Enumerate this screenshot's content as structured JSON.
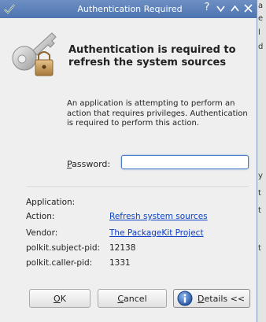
{
  "window": {
    "title": "Authentication Required",
    "help_glyph": "?",
    "minimize_glyph": "v",
    "maximize_glyph": "^",
    "close_glyph": "x"
  },
  "heading": "Authentication is required to refresh the system sources",
  "description": "An application is attempting to perform an action that requires privileges. Authentication is required to perform this action.",
  "password": {
    "label_mnemonic": "P",
    "label_rest": "assword:",
    "value": ""
  },
  "details": {
    "application_label": "Application:",
    "application_value": "",
    "action_label": "Action:",
    "action_value": "Refresh system sources",
    "vendor_label": "Vendor:",
    "vendor_value": "The PackageKit Project",
    "subject_pid_label": "polkit.subject-pid:",
    "subject_pid_value": "12138",
    "caller_pid_label": "polkit.caller-pid:",
    "caller_pid_value": "1331"
  },
  "buttons": {
    "ok_mnemonic": "O",
    "ok_rest": "K",
    "cancel_mnemonic": "C",
    "cancel_rest": "ancel",
    "details_mnemonic": "D",
    "details_rest": "etails <<"
  },
  "background_fragments": [
    "a",
    "e",
    "l",
    "d",
    "y",
    "t",
    "t",
    "t"
  ],
  "colors": {
    "titlebar": "#5a7fbb",
    "link": "#0b3fc6",
    "focus": "#4a7cc6"
  },
  "icons": {
    "app": "authentication-check-icon",
    "main": "key-lock-icon",
    "details": "info-icon"
  }
}
